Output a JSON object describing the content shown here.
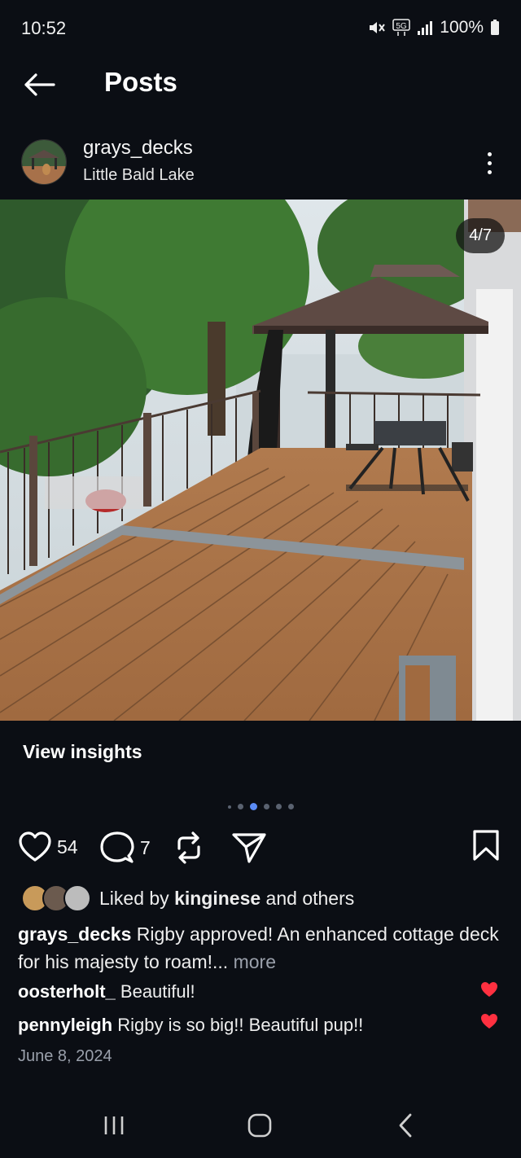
{
  "status_bar": {
    "time": "10:52",
    "battery": "100%",
    "icons": [
      "mute-icon",
      "5g-icon",
      "signal-icon",
      "battery-icon"
    ]
  },
  "header": {
    "title": "Posts",
    "back_icon": "arrow-left-icon"
  },
  "post": {
    "username": "grays_decks",
    "location": "Little Bald Lake",
    "image_counter": "4/7",
    "image_index": 4,
    "image_total": 7,
    "insights_label": "View insights",
    "likes_count": "54",
    "comments_count": "7",
    "liked_by_prefix": "Liked by ",
    "liked_by_user": "kinginese",
    "liked_by_suffix": " and others",
    "caption_user": "grays_decks",
    "caption_text": " Rigby approved!  An enhanced cottage deck for his majesty to roam!...",
    "caption_more": " more",
    "comments": [
      {
        "user": "oosterholt_",
        "text": " Beautiful!"
      },
      {
        "user": "pennyleigh",
        "text": " Rigby is so big!! Beautiful pup!!"
      }
    ],
    "date": "June 8, 2024"
  },
  "colors": {
    "background": "#0b0e14",
    "accent_dot": "#5b8cf5",
    "heart_red": "#ff3040",
    "muted_text": "#9aa0ab"
  }
}
